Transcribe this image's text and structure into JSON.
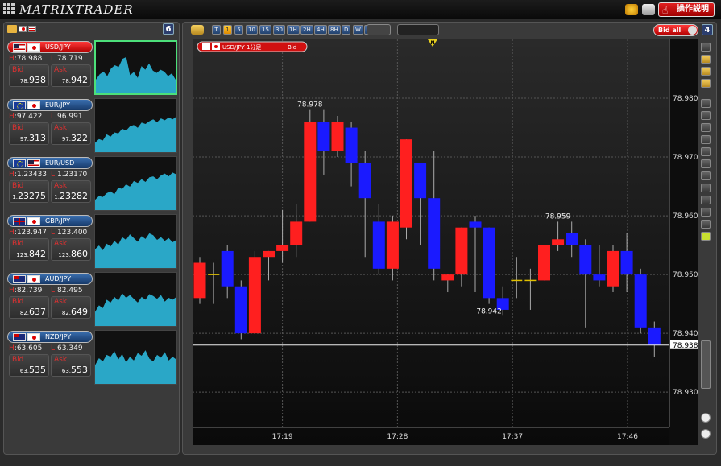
{
  "app": {
    "title": "MATRIXTRADER",
    "help_label": "操作説明"
  },
  "colors": {
    "accent_red": "#e02020",
    "up_candle": "#ff1f1f",
    "down_candle": "#1a1aff",
    "spark_fill": "#2aa7c7",
    "selected_border": "#4ce07a"
  },
  "left": {
    "count": "6",
    "pairs": [
      {
        "name": "USD/JPY",
        "flags": [
          "us",
          "jp"
        ],
        "h_key": "H",
        "h": "78.988",
        "l_key": "L",
        "l": "78.719",
        "bid_label": "Bid",
        "bid_small": "78.",
        "bid_big": "938",
        "ask_label": "Ask",
        "ask_small": "78.",
        "ask_big": "942"
      },
      {
        "name": "EUR/JPY",
        "flags": [
          "eu",
          "jp"
        ],
        "h_key": "H",
        "h": "97.422",
        "l_key": "L",
        "l": "96.991",
        "bid_label": "Bid",
        "bid_small": "97.",
        "bid_big": "313",
        "ask_label": "Ask",
        "ask_small": "97.",
        "ask_big": "322"
      },
      {
        "name": "EUR/USD",
        "flags": [
          "eu",
          "us"
        ],
        "h_key": "H",
        "h": "1.23433",
        "l_key": "L",
        "l": "1.23170",
        "bid_label": "Bid",
        "bid_small": "1.",
        "bid_big": "23275",
        "ask_label": "Ask",
        "ask_small": "1.",
        "ask_big": "23282"
      },
      {
        "name": "GBP/JPY",
        "flags": [
          "gb",
          "jp"
        ],
        "h_key": "H",
        "h": "123.947",
        "l_key": "L",
        "l": "123.400",
        "bid_label": "Bid",
        "bid_small": "123.",
        "bid_big": "842",
        "ask_label": "Ask",
        "ask_small": "123.",
        "ask_big": "860"
      },
      {
        "name": "AUD/JPY",
        "flags": [
          "au",
          "jp"
        ],
        "h_key": "H",
        "h": "82.739",
        "l_key": "L",
        "l": "82.495",
        "bid_label": "Bid",
        "bid_small": "82.",
        "bid_big": "637",
        "ask_label": "Ask",
        "ask_small": "82.",
        "ask_big": "649"
      },
      {
        "name": "NZD/JPY",
        "flags": [
          "nz",
          "jp"
        ],
        "h_key": "H",
        "h": "63.605",
        "l_key": "L",
        "l": "63.349",
        "bid_label": "Bid",
        "bid_small": "63.",
        "bid_big": "535",
        "ask_label": "Ask",
        "ask_small": "63.",
        "ask_big": "553"
      }
    ]
  },
  "main": {
    "count": "4",
    "timeframes": [
      "T",
      "1",
      "5",
      "10",
      "15",
      "30",
      "1H",
      "2H",
      "4H",
      "8H",
      "D",
      "W",
      "M"
    ],
    "selected_timeframe": "1",
    "bid_toggle_label": "Bid all",
    "chart_tag": {
      "pair": "USD/JPY 1分足",
      "side": "Bid"
    },
    "news_marker": "N",
    "tools": [
      "info",
      "news",
      "indicator",
      "alert",
      "cursor",
      "crosshair",
      "trendline",
      "hline",
      "vline",
      "fib",
      "channel",
      "text",
      "pen",
      "eraser",
      "trash",
      "color"
    ]
  },
  "chart_data": {
    "type": "candlestick",
    "ylim": [
      78.924,
      78.99
    ],
    "yticks": [
      "78.930",
      "78.940",
      "78.950",
      "78.960",
      "78.970",
      "78.980"
    ],
    "xticks": [
      "17:19",
      "17:28",
      "17:37",
      "17:46"
    ],
    "current_price": "78.938",
    "annotations": [
      {
        "text": "78.978",
        "index": 8,
        "at": "high"
      },
      {
        "text": "78.942",
        "index": 21,
        "at": "low"
      },
      {
        "text": "78.959",
        "index": 26,
        "at": "high"
      }
    ],
    "candles": [
      {
        "o": 78.946,
        "h": 78.953,
        "l": 78.945,
        "c": 78.952
      },
      {
        "o": 78.95,
        "h": 78.952,
        "l": 78.945,
        "c": 78.95
      },
      {
        "o": 78.954,
        "h": 78.955,
        "l": 78.946,
        "c": 78.948
      },
      {
        "o": 78.948,
        "h": 78.949,
        "l": 78.939,
        "c": 78.94
      },
      {
        "o": 78.94,
        "h": 78.954,
        "l": 78.94,
        "c": 78.953
      },
      {
        "o": 78.953,
        "h": 78.954,
        "l": 78.949,
        "c": 78.954
      },
      {
        "o": 78.954,
        "h": 78.961,
        "l": 78.952,
        "c": 78.955
      },
      {
        "o": 78.955,
        "h": 78.962,
        "l": 78.953,
        "c": 78.959
      },
      {
        "o": 78.959,
        "h": 78.978,
        "l": 78.959,
        "c": 78.976
      },
      {
        "o": 78.976,
        "h": 78.978,
        "l": 78.967,
        "c": 78.971
      },
      {
        "o": 78.971,
        "h": 78.977,
        "l": 78.97,
        "c": 78.976
      },
      {
        "o": 78.975,
        "h": 78.976,
        "l": 78.965,
        "c": 78.969
      },
      {
        "o": 78.969,
        "h": 78.971,
        "l": 78.953,
        "c": 78.963
      },
      {
        "o": 78.959,
        "h": 78.962,
        "l": 78.95,
        "c": 78.951
      },
      {
        "o": 78.951,
        "h": 78.96,
        "l": 78.949,
        "c": 78.959
      },
      {
        "o": 78.958,
        "h": 78.973,
        "l": 78.956,
        "c": 78.973
      },
      {
        "o": 78.969,
        "h": 78.969,
        "l": 78.955,
        "c": 78.963
      },
      {
        "o": 78.963,
        "h": 78.971,
        "l": 78.949,
        "c": 78.951
      },
      {
        "o": 78.949,
        "h": 78.95,
        "l": 78.947,
        "c": 78.95
      },
      {
        "o": 78.95,
        "h": 78.958,
        "l": 78.948,
        "c": 78.958
      },
      {
        "o": 78.959,
        "h": 78.96,
        "l": 78.947,
        "c": 78.958
      },
      {
        "o": 78.958,
        "h": 78.958,
        "l": 78.945,
        "c": 78.946
      },
      {
        "o": 78.946,
        "h": 78.948,
        "l": 78.943,
        "c": 78.944
      },
      {
        "o": 78.949,
        "h": 78.953,
        "l": 78.946,
        "c": 78.949
      },
      {
        "o": 78.949,
        "h": 78.951,
        "l": 78.944,
        "c": 78.949
      },
      {
        "o": 78.949,
        "h": 78.955,
        "l": 78.949,
        "c": 78.955
      },
      {
        "o": 78.955,
        "h": 78.959,
        "l": 78.954,
        "c": 78.956
      },
      {
        "o": 78.957,
        "h": 78.959,
        "l": 78.953,
        "c": 78.955
      },
      {
        "o": 78.955,
        "h": 78.956,
        "l": 78.941,
        "c": 78.95
      },
      {
        "o": 78.95,
        "h": 78.955,
        "l": 78.948,
        "c": 78.949
      },
      {
        "o": 78.948,
        "h": 78.955,
        "l": 78.947,
        "c": 78.954
      },
      {
        "o": 78.954,
        "h": 78.957,
        "l": 78.947,
        "c": 78.95
      },
      {
        "o": 78.95,
        "h": 78.951,
        "l": 78.94,
        "c": 78.941
      },
      {
        "o": 78.941,
        "h": 78.942,
        "l": 78.936,
        "c": 78.938
      }
    ],
    "sparklines": [
      [
        0.3,
        0.42,
        0.48,
        0.38,
        0.55,
        0.62,
        0.58,
        0.76,
        0.8,
        0.4,
        0.47,
        0.34,
        0.6,
        0.52,
        0.66,
        0.5,
        0.45,
        0.52,
        0.48,
        0.38,
        0.44,
        0.3
      ],
      [
        0.2,
        0.28,
        0.25,
        0.38,
        0.33,
        0.42,
        0.4,
        0.5,
        0.46,
        0.55,
        0.58,
        0.52,
        0.63,
        0.6,
        0.66,
        0.7,
        0.64,
        0.72,
        0.68,
        0.74,
        0.7,
        0.76
      ],
      [
        0.22,
        0.3,
        0.28,
        0.36,
        0.4,
        0.34,
        0.48,
        0.45,
        0.55,
        0.5,
        0.62,
        0.58,
        0.66,
        0.6,
        0.7,
        0.72,
        0.66,
        0.74,
        0.78,
        0.72,
        0.8,
        0.76
      ],
      [
        0.4,
        0.48,
        0.38,
        0.52,
        0.46,
        0.58,
        0.5,
        0.66,
        0.6,
        0.72,
        0.64,
        0.56,
        0.68,
        0.62,
        0.74,
        0.7,
        0.6,
        0.66,
        0.58,
        0.64,
        0.55,
        0.6
      ],
      [
        0.3,
        0.44,
        0.38,
        0.56,
        0.5,
        0.62,
        0.54,
        0.7,
        0.6,
        0.66,
        0.58,
        0.5,
        0.62,
        0.56,
        0.68,
        0.64,
        0.58,
        0.66,
        0.52,
        0.6,
        0.56,
        0.62
      ],
      [
        0.4,
        0.55,
        0.48,
        0.62,
        0.58,
        0.7,
        0.52,
        0.64,
        0.46,
        0.58,
        0.5,
        0.66,
        0.6,
        0.72,
        0.54,
        0.48,
        0.62,
        0.56,
        0.68,
        0.5,
        0.58,
        0.52
      ]
    ]
  }
}
